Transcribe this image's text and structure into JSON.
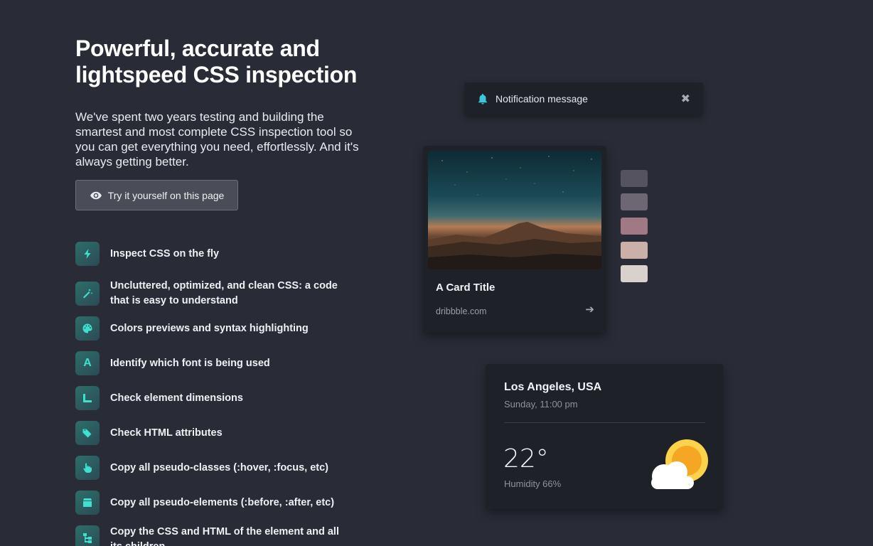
{
  "hero": {
    "title_line1": "Powerful, accurate and",
    "title_line2": "lightspeed CSS inspection",
    "description": "We've spent two years testing and building the smartest and most complete CSS inspection tool so you can get everything you need, effortlessly. And it's always getting better.",
    "cta_label": "Try it yourself on this page",
    "cta_icon": "eye-icon"
  },
  "features": [
    {
      "icon": "lightning-icon",
      "text": "Inspect CSS on the fly"
    },
    {
      "icon": "magic-wand-icon",
      "text": "Uncluttered, optimized, and clean CSS: a code that is easy to understand"
    },
    {
      "icon": "palette-icon",
      "text": "Colors previews and syntax highlighting"
    },
    {
      "icon": "font-icon",
      "text": "Identify which font is being used"
    },
    {
      "icon": "ruler-icon",
      "text": "Check element dimensions"
    },
    {
      "icon": "tag-icon",
      "text": "Check HTML attributes"
    },
    {
      "icon": "pointer-icon",
      "text": "Copy all pseudo-classes (:hover, :focus, etc)"
    },
    {
      "icon": "box-icon",
      "text": "Copy all pseudo-elements (:before, :after, etc)"
    },
    {
      "icon": "tree-icon",
      "text": "Copy the CSS and HTML of the element and all its children"
    }
  ],
  "font_icon_glyph": "A",
  "notification": {
    "message": "Notification message",
    "close_glyph": "✖",
    "accent": "#3cc8d6"
  },
  "card": {
    "title": "A Card Title",
    "link": "dribbble.com",
    "arrow_glyph": "➔"
  },
  "swatches": [
    "#55535f",
    "#6d6673",
    "#a07985",
    "#cbb0a7",
    "#d8d1cc"
  ],
  "weather": {
    "city": "Los Angeles, USA",
    "time": "Sunday, 11:00 pm",
    "temperature": "22°",
    "humidity": "Humidity 66%",
    "icon": "partly-cloudy-icon"
  },
  "colors": {
    "background": "#292c37",
    "panel": "#1f2128",
    "accent": "#3fe0cf"
  }
}
